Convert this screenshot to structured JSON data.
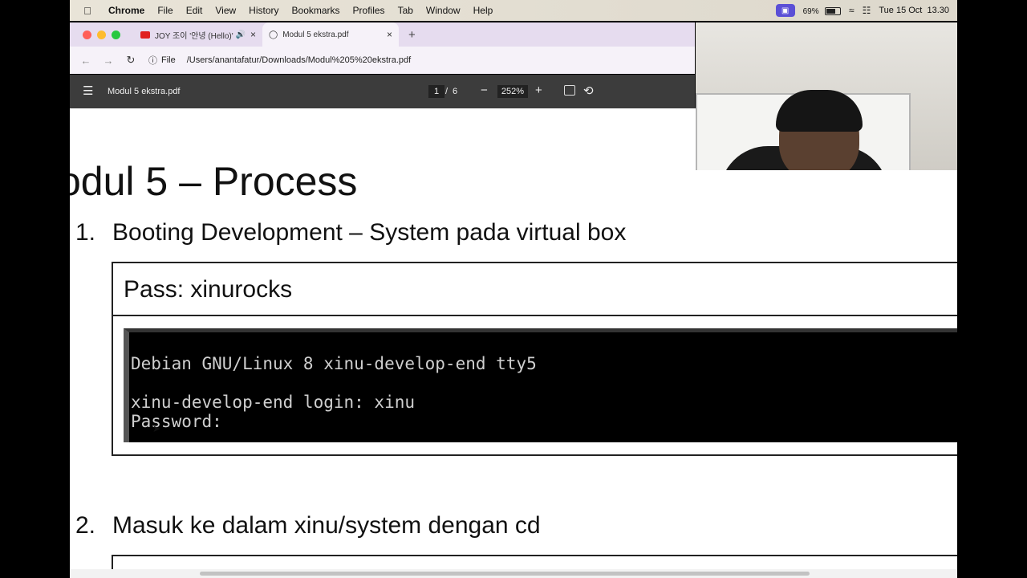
{
  "menubar": {
    "items": [
      "Chrome",
      "File",
      "Edit",
      "View",
      "History",
      "Bookmarks",
      "Profiles",
      "Tab",
      "Window",
      "Help"
    ],
    "battery_percent": "69%",
    "battery_level": 0.69,
    "clock": "Tue 15 Oct  13.30"
  },
  "tabs": [
    {
      "label": "JOY 조이 '안녕 (Hello)' MV",
      "icon": "youtube-icon"
    },
    {
      "label": "Modul 5 ekstra.pdf",
      "icon": "globe-icon"
    }
  ],
  "address": {
    "chip": "File",
    "url": "/Users/anantafatur/Downloads/Modul%205%20ekstra.pdf"
  },
  "pdf": {
    "title": "Modul 5 ekstra.pdf",
    "page": "1",
    "separator": "/",
    "total_pages": "6",
    "zoom": "252%"
  },
  "doc": {
    "heading": "odul 5 – Process",
    "step1_num": "1.",
    "step1_text": "Booting Development – System pada virtual box",
    "pass_text": "Pass: xinurocks",
    "terminal_lines": [
      "Debian GNU/Linux 8 xinu-develop-end tty5",
      "",
      "xinu-develop-end login: xinu",
      "Password:"
    ],
    "step2_num": "2.",
    "step2_text": "Masuk ke dalam xinu/system dengan cd"
  }
}
